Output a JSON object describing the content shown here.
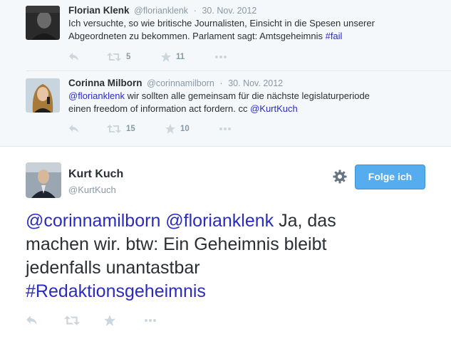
{
  "context_tweets": [
    {
      "name": "Florian Klenk",
      "handle": "@florianklenk",
      "separator": "·",
      "date": "30. Nov. 2012",
      "line1": "Ich versuchte, so wie britische Journalisten, Einsicht in die Spesen unserer",
      "line2_text": "Abgeordneten zu bekommen. Parlament sagt: Amtsgeheimnis ",
      "line2_hashtag": "#fail",
      "retweets": "5",
      "favorites": "11"
    },
    {
      "name": "Corinna Milborn",
      "handle": "@corinnamilborn",
      "separator": "·",
      "date": "30. Nov. 2012",
      "line1_mention": "@florianklenk",
      "line1_text": " wir sollten alle gemeinsam für die nächste legislaturperiode",
      "line2_text": "einen freedom of information act fordern. cc ",
      "line2_mention": "@KurtKuch",
      "retweets": "15",
      "favorites": "10"
    }
  ],
  "main_tweet": {
    "name": "Kurt Kuch",
    "handle": "@KurtKuch",
    "follow_label": "Folge ich",
    "mention1": "@corinnamilborn",
    "mention2": "@florianklenk",
    "text1": " Ja, das",
    "text2": "machen wir. btw: Ein Geheimnis bleibt",
    "text3": "jedenfalls unantastbar",
    "hashtag": "#Redaktionsgeheimnis"
  },
  "icons": [
    "reply-icon",
    "retweet-icon",
    "favorite-icon",
    "more-icon",
    "gear-icon"
  ],
  "colors": {
    "accent": "#55acee",
    "mention": "#2b2bc0",
    "link": "#2b7bb9",
    "muted": "#8899a6",
    "context_bg": "#f5f8fa"
  }
}
